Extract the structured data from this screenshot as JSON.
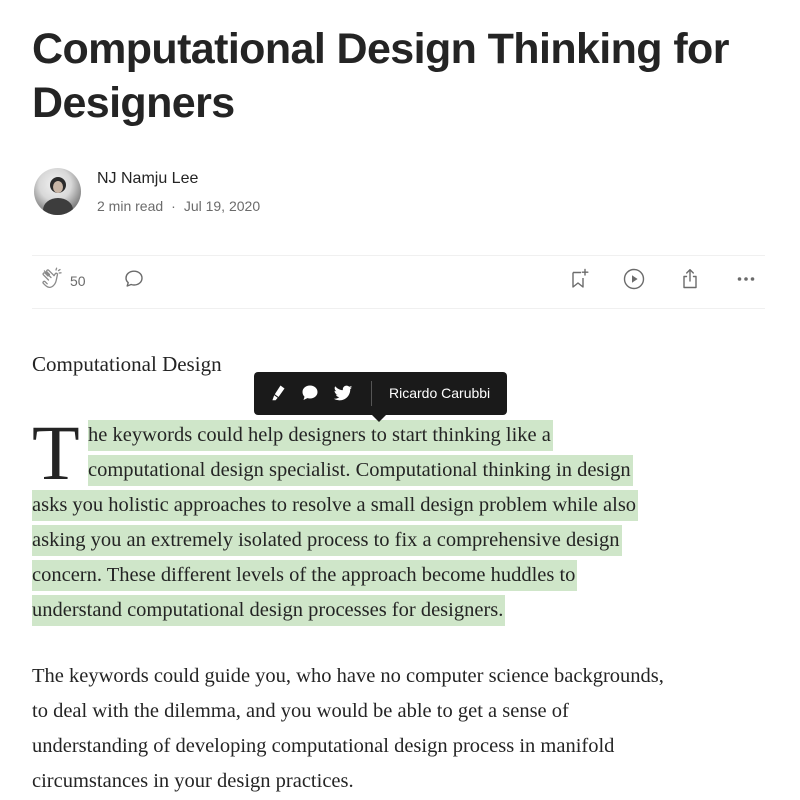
{
  "article": {
    "title": "Computational Design Thinking for Designers",
    "subtitle": "Computational Design",
    "author": {
      "name": "NJ Namju Lee",
      "read_time": "2 min read",
      "separator": "·",
      "date": "Jul 19, 2020"
    },
    "actions": {
      "clap_count": "50",
      "icons": [
        "clap-icon",
        "comment-icon",
        "bookmark-icon",
        "play-icon",
        "share-icon",
        "more-icon"
      ]
    },
    "highlight_tooltip": {
      "icons": [
        "highlight-pen-icon",
        "respond-icon",
        "twitter-icon"
      ],
      "highlighter_name": "Ricardo Carubbi"
    },
    "dropcap": "T",
    "paragraph1_lines": [
      "he keywords could help designers to start thinking like a",
      "computational design specialist. Computational thinking in design",
      "asks you holistic approaches to resolve a small design problem while also",
      "asking you an extremely isolated process to fix a comprehensive design",
      "concern. These different levels of the approach become huddles to",
      "understand computational design processes for designers."
    ],
    "paragraph2_lines": [
      "The keywords could guide you, who have no computer science backgrounds,",
      "to deal with the dilemma, and you would be able to get a sense of",
      "understanding of developing computational design process in manifold",
      "circumstances in your design practices."
    ]
  },
  "colors": {
    "text": "#242424",
    "muted": "#6b6b6b",
    "highlight": "#cfe6c9",
    "tooltip_bg": "#1a1a1a"
  }
}
